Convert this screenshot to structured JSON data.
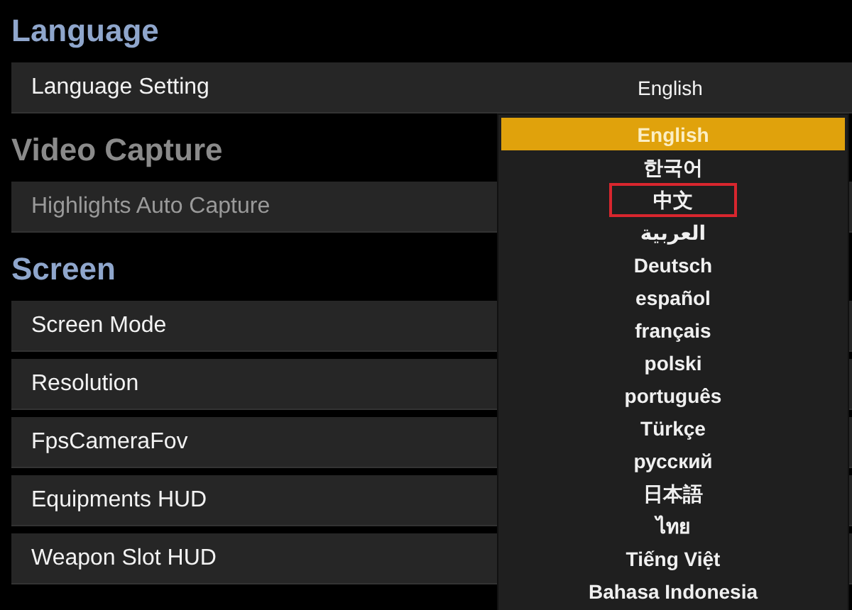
{
  "sections": [
    {
      "title": "Language",
      "disabled": false,
      "rows": [
        {
          "label": "Language Setting",
          "value": "English"
        }
      ]
    },
    {
      "title": "Video Capture",
      "disabled": true,
      "rows": [
        {
          "label": "Highlights Auto Capture"
        }
      ]
    },
    {
      "title": "Screen",
      "disabled": false,
      "rows": [
        {
          "label": "Screen Mode"
        },
        {
          "label": "Resolution"
        },
        {
          "label": "FpsCameraFov"
        },
        {
          "label": "Equipments HUD"
        },
        {
          "label": "Weapon Slot HUD"
        }
      ]
    }
  ],
  "language_dropdown": {
    "items": [
      {
        "label": "English",
        "selected": true,
        "highlighted": false
      },
      {
        "label": "한국어",
        "selected": false,
        "highlighted": false
      },
      {
        "label": "中文",
        "selected": false,
        "highlighted": true
      },
      {
        "label": "العربية",
        "selected": false,
        "highlighted": false
      },
      {
        "label": "Deutsch",
        "selected": false,
        "highlighted": false
      },
      {
        "label": "español",
        "selected": false,
        "highlighted": false
      },
      {
        "label": "français",
        "selected": false,
        "highlighted": false
      },
      {
        "label": "polski",
        "selected": false,
        "highlighted": false
      },
      {
        "label": "português",
        "selected": false,
        "highlighted": false
      },
      {
        "label": "Türkçe",
        "selected": false,
        "highlighted": false
      },
      {
        "label": "русский",
        "selected": false,
        "highlighted": false
      },
      {
        "label": "日本語",
        "selected": false,
        "highlighted": false
      },
      {
        "label": "ไทย",
        "selected": false,
        "highlighted": false
      },
      {
        "label": "Tiếng Việt",
        "selected": false,
        "highlighted": false
      },
      {
        "label": "Bahasa Indonesia",
        "selected": false,
        "highlighted": false
      }
    ]
  }
}
